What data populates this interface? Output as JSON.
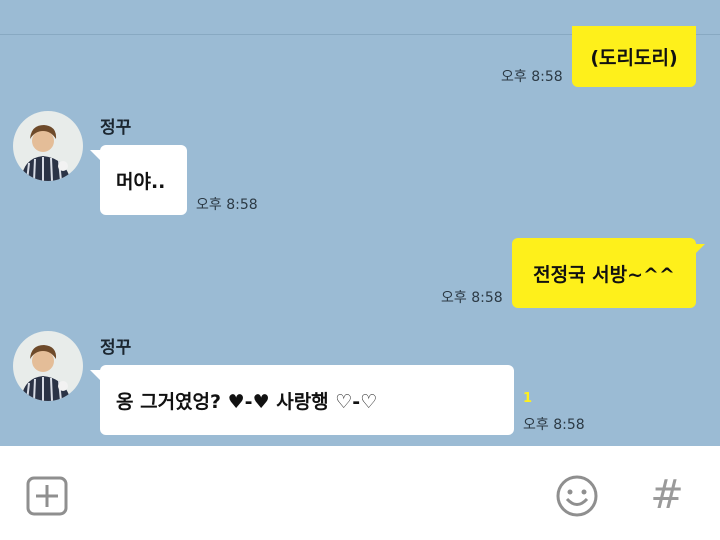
{
  "messages": [
    {
      "side": "me",
      "text": "(도리도리)",
      "time": "오후 8:58"
    },
    {
      "side": "them",
      "sender": "정꾸",
      "text": "머야..",
      "time": "오후 8:58"
    },
    {
      "side": "me",
      "text": "전정국 서방~^^",
      "time": "오후 8:58"
    },
    {
      "side": "them",
      "sender": "정꾸",
      "text": "옹 그거였엉?  ♥-♥   사랑행 ♡-♡",
      "time": "오후 8:58",
      "unread": "1"
    }
  ],
  "composer": {
    "add_icon": "plus-square-icon",
    "emoji_icon": "smiley-icon",
    "hashtag_icon": "hashtag-icon",
    "hashtag_glyph": "#"
  },
  "colors": {
    "chat_background": "#9bbbd4",
    "my_bubble": "#fef01b",
    "their_bubble": "#ffffff",
    "unread_count": "#fef01b"
  }
}
